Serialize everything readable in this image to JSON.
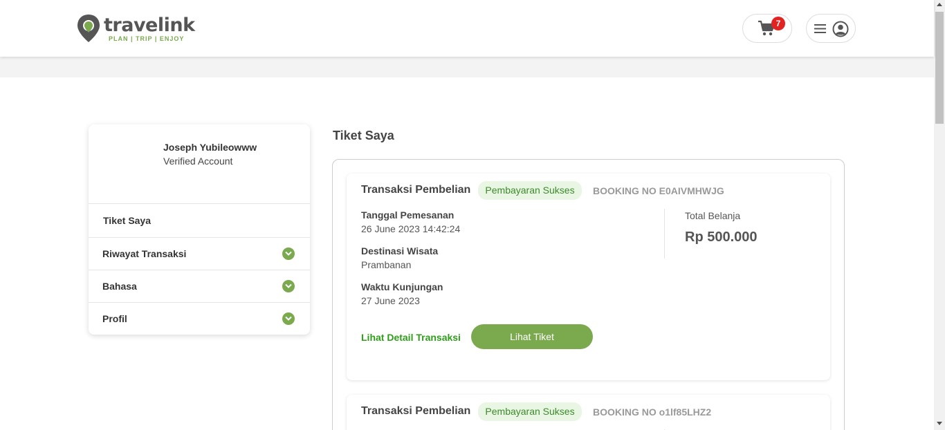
{
  "header": {
    "logo_text": "travelink",
    "logo_tagline": "PLAN | TRIP | ENJOY",
    "cart_count": "7",
    "brand_color": "#7aa94e",
    "badge_color": "#e32321"
  },
  "sidebar": {
    "user_name": "Joseph Yubileowww",
    "user_status": "Verified Account",
    "items": [
      {
        "label": "Tiket Saya",
        "expandable": false
      },
      {
        "label": "Riwayat Transaksi",
        "expandable": true
      },
      {
        "label": "Bahasa",
        "expandable": true
      },
      {
        "label": "Profil",
        "expandable": true
      }
    ]
  },
  "main": {
    "title": "Tiket Saya",
    "transactions": [
      {
        "title": "Transaksi Pembelian",
        "status": "Pembayaran Sukses",
        "booking": "BOOKING NO E0AIVMHWJG",
        "order_date_label": "Tanggal Pemesanan",
        "order_date": "26 June 2023 14:42:24",
        "destination_label": "Destinasi Wisata",
        "destination": "Prambanan",
        "visit_label": "Waktu Kunjungan",
        "visit_date": "27 June 2023",
        "total_label": "Total Belanja",
        "total": "Rp 500.000",
        "detail_link": "Lihat Detail Transaksi",
        "ticket_button": "Lihat Tiket"
      },
      {
        "title": "Transaksi Pembelian",
        "status": "Pembayaran Sukses",
        "booking": "BOOKING NO o1lf85LHZ2"
      }
    ]
  }
}
